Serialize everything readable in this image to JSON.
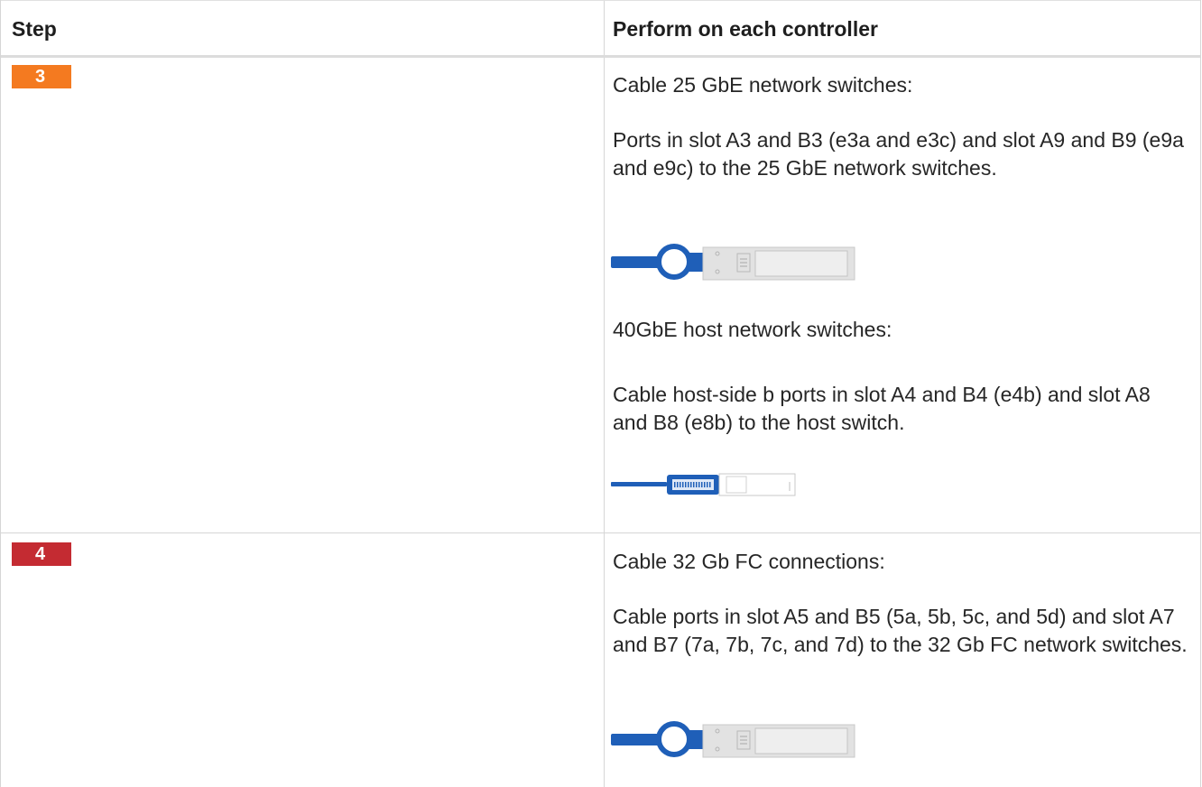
{
  "table": {
    "headers": {
      "step": "Step",
      "perform": "Perform on each controller"
    },
    "rows": [
      {
        "badge": {
          "label": "3",
          "color": "#f47a20"
        },
        "paragraphs": [
          "Cable 25 GbE network switches:",
          "Ports in slot A3 and B3 (e3a and e3c) and slot A9 and B9 (e9a and e9c) to the 25 GbE network switches.",
          "40GbE host network switches:",
          "Cable host-side b ports in slot A4 and B4 (e4b) and slot A8 and B8 (e8b) to the host switch."
        ],
        "connectors": [
          "sfp28-cable-icon",
          "qsfp-cable-icon"
        ]
      },
      {
        "badge": {
          "label": "4",
          "color": "#c42b32"
        },
        "paragraphs": [
          "Cable 32 Gb FC connections:",
          "Cable ports in slot A5 and B5 (5a, 5b, 5c, and 5d) and slot A7 and B7 (7a, 7b, 7c, and 7d) to the 32 Gb FC network switches."
        ],
        "connectors": [
          "sfp28-cable-icon"
        ]
      }
    ]
  },
  "colors": {
    "cable_blue": "#1f5fb8",
    "connector_gray": "#dcdcdc",
    "border": "#d6d6d6"
  }
}
